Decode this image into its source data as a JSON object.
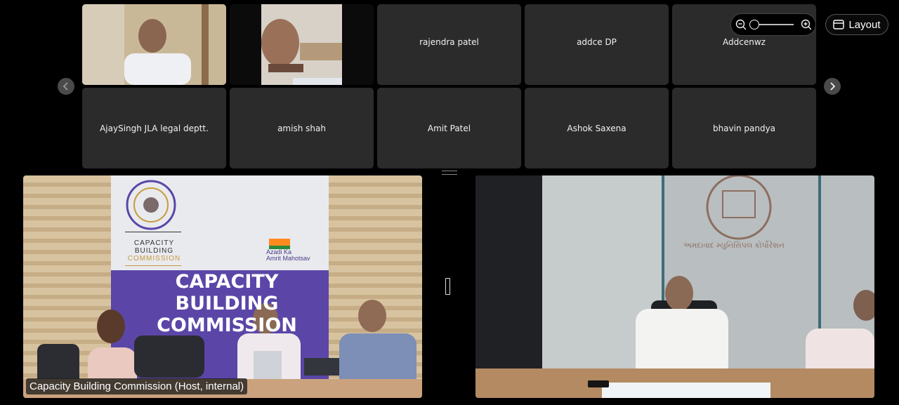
{
  "participants": [
    {
      "name": "",
      "video": true
    },
    {
      "name": "",
      "video": true
    },
    {
      "name": "rajendra patel"
    },
    {
      "name": "addce DP"
    },
    {
      "name": "Addcenwz"
    },
    {
      "name": "AjaySingh JLA legal deptt."
    },
    {
      "name": "amish shah"
    },
    {
      "name": "Amit Patel"
    },
    {
      "name": "Ashok Saxena"
    },
    {
      "name": "bhavin pandya"
    }
  ],
  "toolbar": {
    "layout_label": "Layout"
  },
  "main_video": {
    "caption": "Capacity Building Commission (Host, internal)",
    "banner_title_lines": [
      "CAPACITY",
      "BUILDING",
      "COMMISSION"
    ],
    "logo_text_lines": [
      "CAPACITY",
      "BUILDING",
      "COMMISSION"
    ],
    "badge_text": [
      "Azadi",
      "Ka",
      "Amrit Mahotsav"
    ]
  },
  "second_video": {
    "emblem_text": "અમદાવાદ મ્યુનિસિપલ કોર્પોરેશન"
  },
  "colors": {
    "tile_bg": "#2b2b2b",
    "banner_purple": "#5b46a8"
  }
}
